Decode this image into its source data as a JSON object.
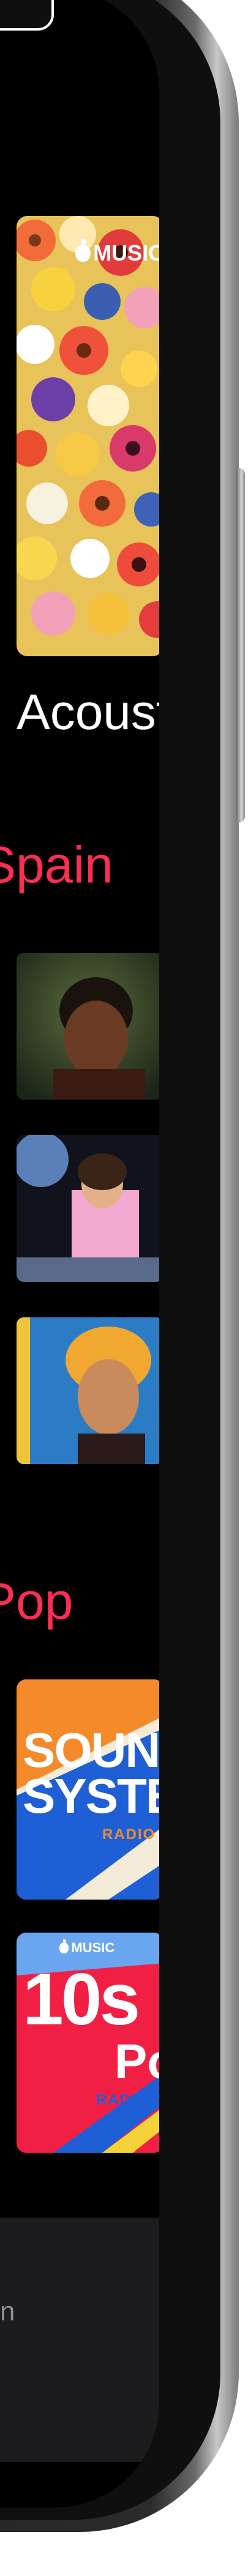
{
  "featured": {
    "badge_text": "MUSIC",
    "caption": "Acoustic"
  },
  "sections": [
    {
      "title": "Spain"
    },
    {
      "title": "Pop"
    }
  ],
  "artists": [
    "artist-1",
    "artist-2",
    "artist-3"
  ],
  "radio_tiles": [
    {
      "line1": "SOUND",
      "line2": "SYSTEM",
      "line3": "RADIO"
    },
    {
      "badge": "MUSIC",
      "line1": "10s",
      "line2": "Pop",
      "line3": "RADIO"
    }
  ],
  "tab_bar": {
    "visible_label": "n"
  },
  "colors": {
    "accent": "#ff2d55",
    "background": "#000000",
    "tab_bar": "#1c1c1e"
  }
}
